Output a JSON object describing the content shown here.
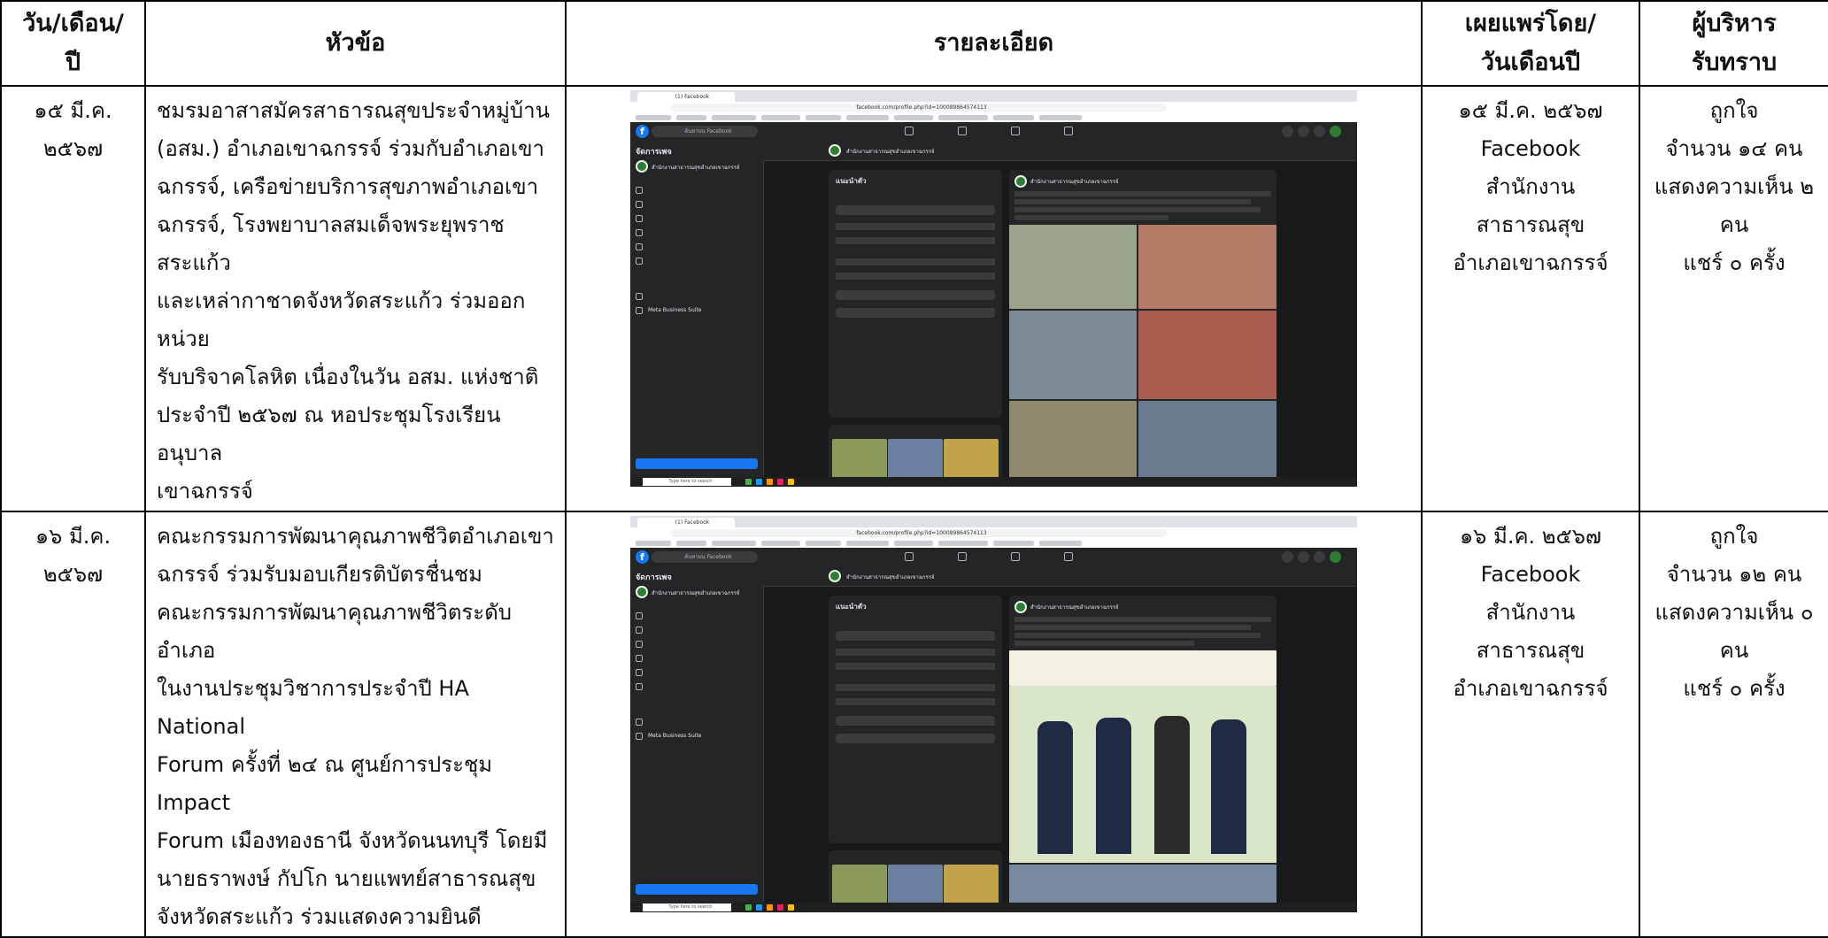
{
  "header": {
    "date_col": [
      "วัน/เดือน/",
      "ปี"
    ],
    "topic_col": "หัวข้อ",
    "detail_col": "รายละเอียด",
    "published_col": [
      "เผยแพร่โดย/",
      "วันเดือนปี"
    ],
    "exec_col": [
      "ผู้บริหาร",
      "รับทราบ"
    ]
  },
  "rows": [
    {
      "date": [
        "๑๕ มี.ค.",
        "๒๕๖๗"
      ],
      "topic": [
        "ชมรมอาสาสมัครสาธารณสุขประจำหมู่บ้าน",
        "(อสม.) อำเภอเขาฉกรรจ์ ร่วมกับอำเภอเขา",
        "ฉกรรจ์, เครือข่ายบริการสุขภาพอำเภอเขา",
        "ฉกรรจ์, โรงพยาบาลสมเด็จพระยุพราชสระแก้ว",
        "และเหล่ากาชาดจังหวัดสระแก้ว ร่วมออกหน่วย",
        "รับบริจาคโลหิต เนื่องในวัน อสม. แห่งชาติ",
        "ประจำปี ๒๕๖๗ ณ หอประชุมโรงเรียนอนุบาล",
        "เขาฉกรรจ์"
      ],
      "published": [
        "๑๕ มี.ค. ๒๕๖๗",
        "Facebook",
        "สำนักงานสาธารณสุข",
        "อำเภอเขาฉกรรจ์"
      ],
      "exec": [
        "ถูกใจ",
        "จำนวน ๑๔ คน",
        "แสดงความเห็น ๒",
        "คน",
        "แชร์ ๐ ครั้ง"
      ]
    },
    {
      "date": [
        "๑๖ มี.ค.",
        "๒๕๖๗"
      ],
      "topic": [
        "คณะกรรมการพัฒนาคุณภาพชีวิตอำเภอเขา",
        "ฉกรรจ์ ร่วมรับมอบเกียรติบัตรชื่นชม",
        "คณะกรรมการพัฒนาคุณภาพชีวิตระดับอำเภอ",
        "ในงานประชุมวิชาการประจำปี HA National",
        "Forum ครั้งที่ ๒๔ ณ ศูนย์การประชุม Impact",
        "Forum เมืองทองธานี จังหวัดนนทบุรี โดยมี",
        "นายธราพงษ์   กัปโก นายแพทย์สาธารณสุข",
        "จังหวัดสระแก้ว ร่วมแสดงความยินดี"
      ],
      "published": [
        "๑๖ มี.ค. ๒๕๖๗",
        "Facebook",
        "สำนักงานสาธารณสุข",
        "อำเภอเขาฉกรรจ์"
      ],
      "exec": [
        "ถูกใจ",
        "จำนวน ๑๒ คน",
        "แสดงความเห็น ๐",
        "คน",
        "แชร์ ๐ ครั้ง"
      ]
    }
  ],
  "screenshot": {
    "tab_label": "(1) Facebook",
    "url": "facebook.com/profile.php?id=100089864574113",
    "search_placeholder": "ค้นหาบน Facebook",
    "sidebar_title": "จัดการเพจ",
    "page_name": "สำนักงานสาธารณสุขอำเภอเขาฉกรรจ์",
    "meta_business": "Meta Business Suite",
    "intro_title": "แนะนำตัว",
    "taskbar_search": "Type here to search"
  }
}
